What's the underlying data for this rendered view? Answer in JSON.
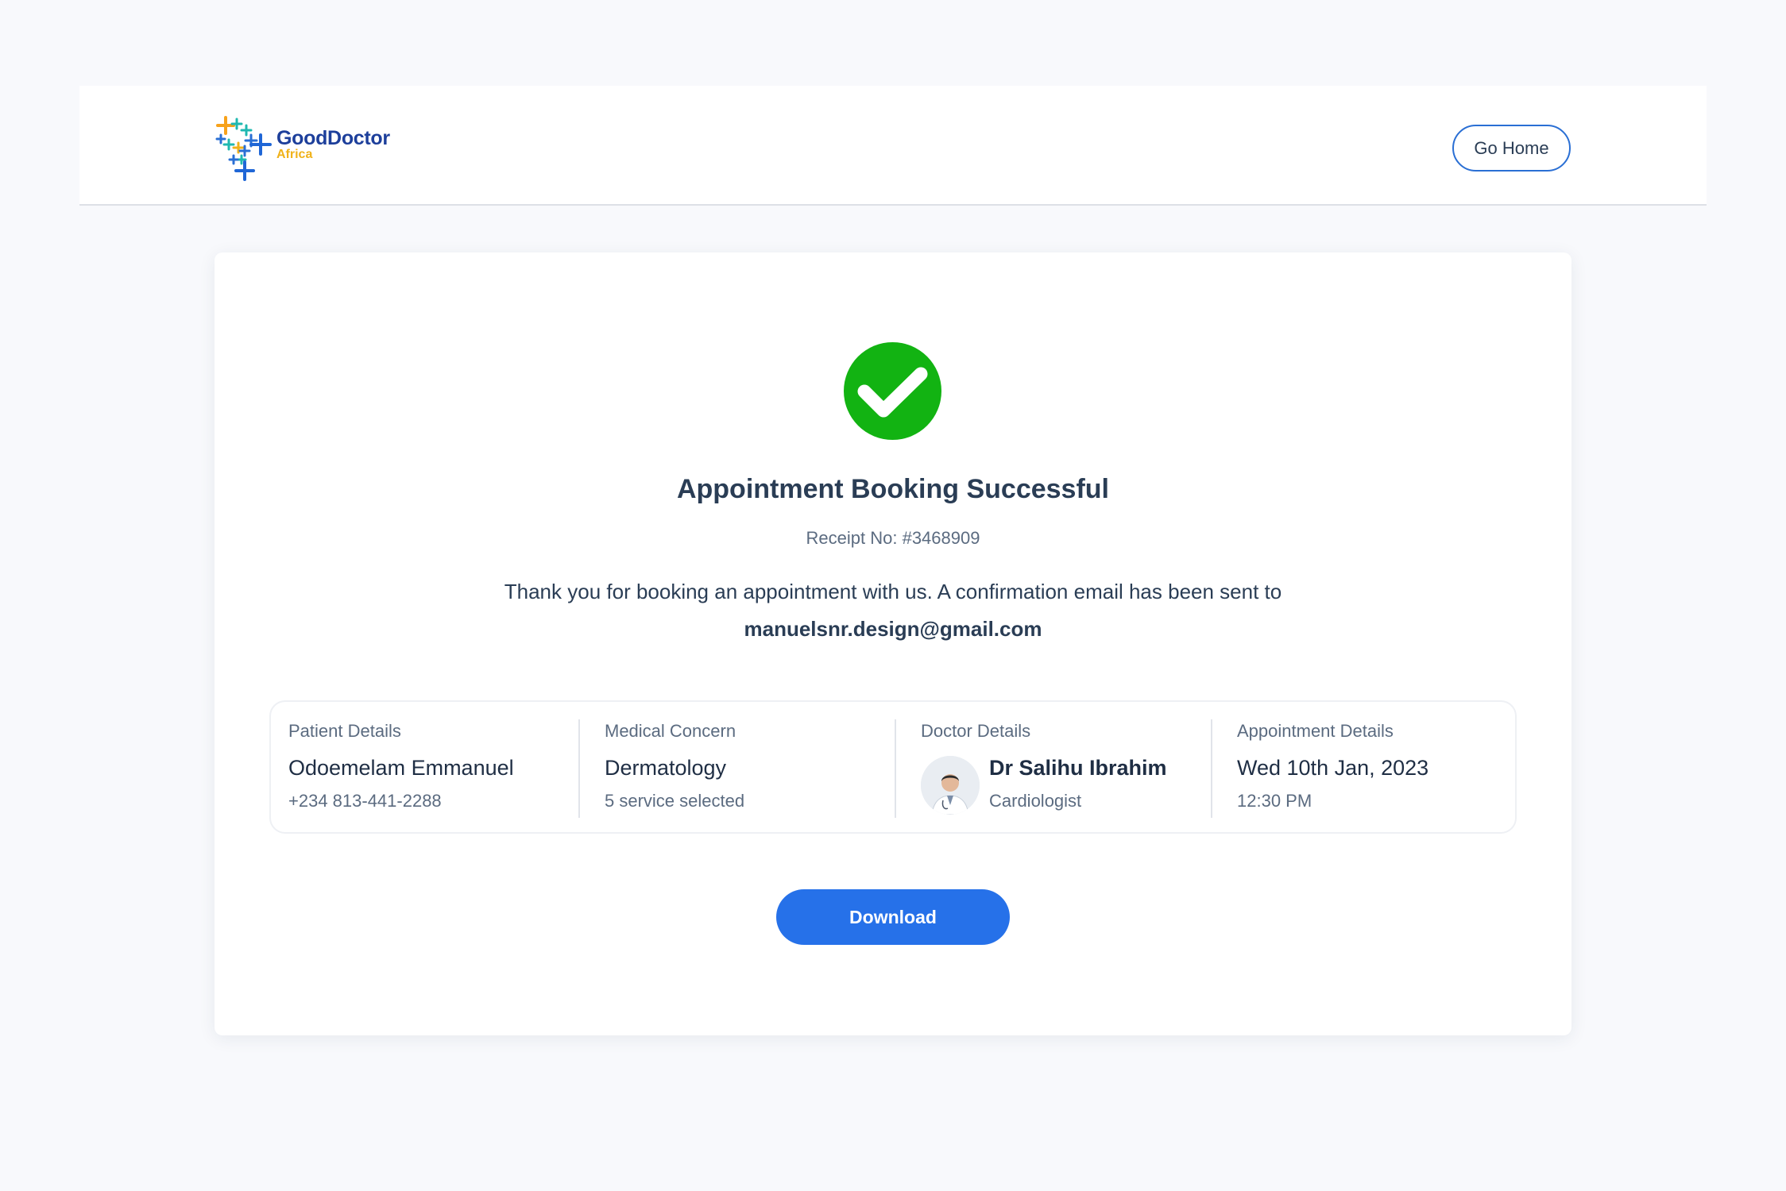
{
  "brand": {
    "name": "GoodDoctor",
    "region": "Africa",
    "colors": {
      "primary": "#1d3f9b",
      "accent": "#f0b21a",
      "teal": "#1fb8b0",
      "button": "#2671e9",
      "success": "#12b312"
    }
  },
  "header": {
    "home_button": "Go Home"
  },
  "confirmation": {
    "status_icon": "check-circle-icon",
    "title": "Appointment Booking Successful",
    "receipt": "Receipt No: #3468909",
    "message_prefix": "Thank you for booking an appointment with us. A confirmation email has been sent to",
    "email": "manuelsnr.design@gmail.com"
  },
  "details": {
    "patient": {
      "label": "Patient Details",
      "name": "Odoemelam Emmanuel",
      "phone": "+234 813-441-2288"
    },
    "concern": {
      "label": "Medical Concern",
      "name": "Dermatology",
      "services": "5 service selected"
    },
    "doctor": {
      "label": "Doctor Details",
      "name": "Dr Salihu Ibrahim",
      "specialty": "Cardiologist",
      "avatar_icon": "doctor-avatar"
    },
    "appointment": {
      "label": "Appointment Details",
      "date": "Wed 10th Jan, 2023",
      "time": "12:30 PM"
    }
  },
  "actions": {
    "download": "Download"
  }
}
